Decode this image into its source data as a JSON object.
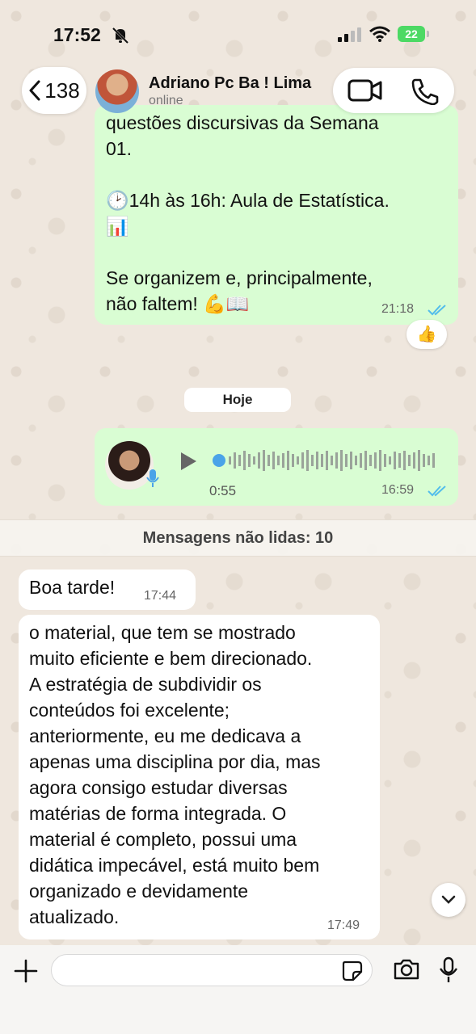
{
  "status_bar": {
    "time": "17:52",
    "battery": "22"
  },
  "header": {
    "back_count": "138",
    "contact_name": "Adriano Pc Ba ! Lima",
    "contact_status": "online"
  },
  "messages_top": {
    "partial_line": "questões discursivas da Semana",
    "text": "01.\n\n🕑14h às 16h: Aula de Estatística.\n📊\n\nSe organizem e, principalmente,\nnão faltem! 💪📖",
    "time": "21:18",
    "reaction": "👍"
  },
  "date_chip": "Hoje",
  "voice_message": {
    "duration": "0:55",
    "time": "16:59"
  },
  "unread_banner": "Mensagens não lidas: 10",
  "incoming": [
    {
      "text": "Boa tarde!",
      "time": "17:44"
    },
    {
      "text": "o material, que tem se mostrado\nmuito eficiente e bem direcionado.\nA estratégia de subdividir os\nconteúdos foi excelente;\nanteriormente, eu me dedicava a\napenas uma disciplina por dia, mas\nagora consigo estudar diversas\nmatérias de forma integrada. O\nmaterial é completo, possui uma\ndidática impecável, está muito bem\norganizado e devidamente\natualizado.",
      "time": "17:49"
    }
  ],
  "input": {
    "value": "",
    "placeholder": ""
  },
  "colors": {
    "outgoing": "#d9fdd3",
    "incoming": "#ffffff",
    "read_ticks": "#53bdeb",
    "wallpaper": "#efe7de",
    "battery": "#4cd964"
  }
}
